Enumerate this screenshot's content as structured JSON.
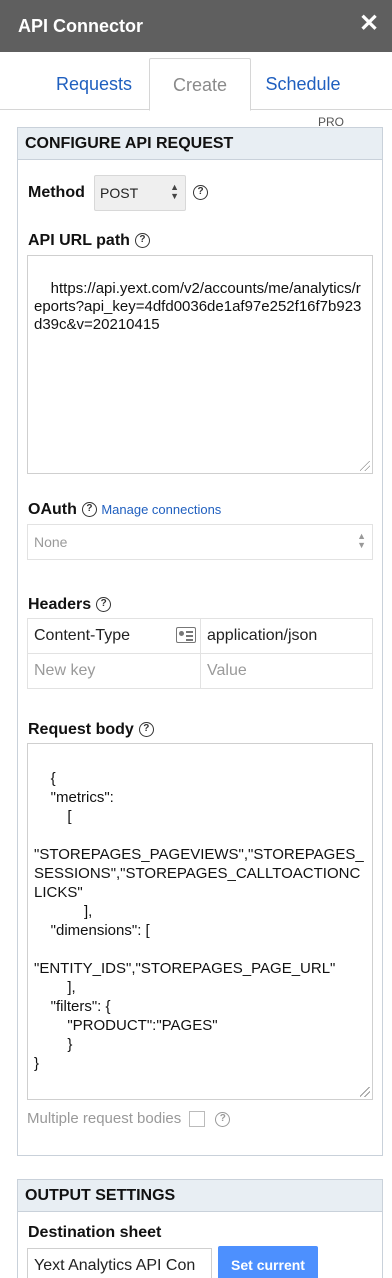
{
  "app": {
    "title": "API Connector",
    "close_glyph": "✕"
  },
  "tabs": {
    "requests": "Requests",
    "create": "Create",
    "schedule": "Schedule",
    "pro_badge": "PRO",
    "active": "Create"
  },
  "configure": {
    "header": "CONFIGURE API REQUEST",
    "method_label": "Method",
    "method_value": "POST",
    "url_label": "API URL path",
    "url_value": "https://api.yext.com/v2/accounts/me/analytics/reports?api_key=4dfd0036de1af97e252f16f7b923d39c&v=20210415",
    "oauth_label": "OAuth",
    "oauth_link": "Manage connections",
    "oauth_value": "None",
    "headers_label": "Headers",
    "headers": [
      {
        "key": "Content-Type",
        "value": "application/json"
      }
    ],
    "new_key_placeholder": "New key",
    "new_value_placeholder": "Value",
    "body_label": "Request body",
    "body_value": "{\n    \"metrics\":\n        [\n\n\"STOREPAGES_PAGEVIEWS\",\"STOREPAGES_SESSIONS\",\"STOREPAGES_CALLTOACTIONCLICKS\"\n            ],\n    \"dimensions\": [\n\n\"ENTITY_IDS\",\"STOREPAGES_PAGE_URL\"\n        ],\n    \"filters\": {\n        \"PRODUCT\":\"PAGES\"\n        }\n}",
    "multiple_bodies_label": "Multiple request bodies"
  },
  "output": {
    "header": "OUTPUT SETTINGS",
    "dest_label": "Destination sheet",
    "dest_value": "Yext Analytics API Con",
    "set_current": "Set current"
  },
  "icons": {
    "help": "help-circle-icon",
    "close": "close-icon",
    "card": "contact-card-icon"
  },
  "colors": {
    "titlebar": "#5f5f5f",
    "link": "#1f5fbf",
    "panel_header": "#e8eef3",
    "button": "#4d90fe"
  }
}
